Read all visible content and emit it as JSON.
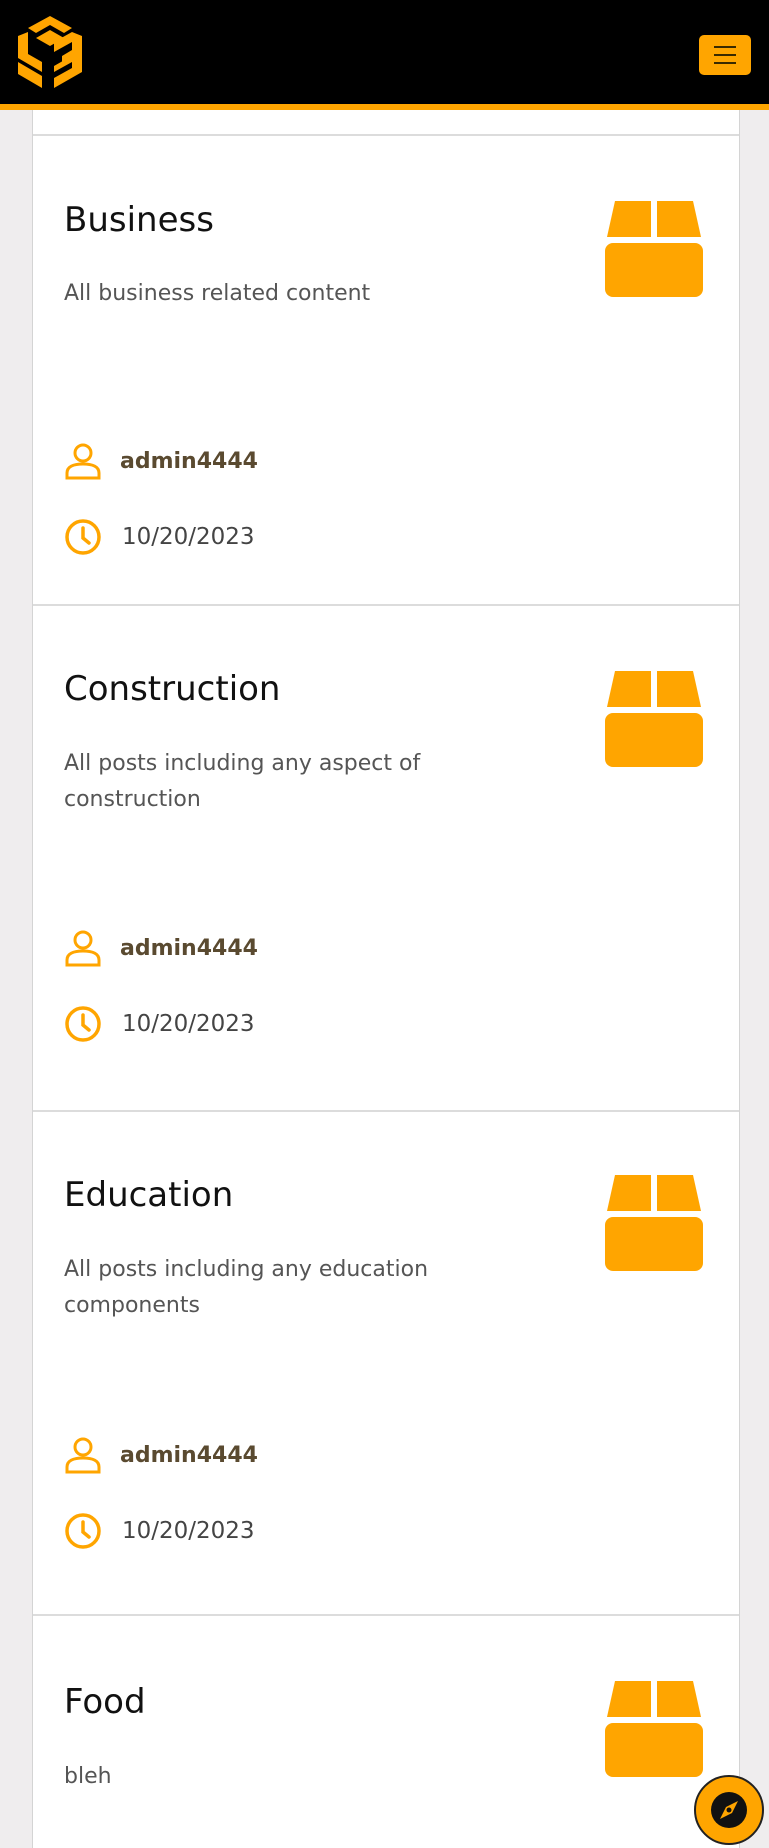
{
  "header": {
    "logo_alt": "site-logo",
    "menu_label": "Toggle navigation"
  },
  "accent_color": "#ffa500",
  "categories": [
    {
      "title": "Business",
      "description": "All business related content",
      "author": "admin4444",
      "date": "10/20/2023",
      "icon": "box-icon"
    },
    {
      "title": "Construction",
      "description": "All posts including any aspect of construction",
      "author": "admin4444",
      "date": "10/20/2023",
      "icon": "box-icon"
    },
    {
      "title": "Education",
      "description": "All posts including any education components",
      "author": "admin4444",
      "date": "10/20/2023",
      "icon": "box-icon"
    },
    {
      "title": "Food",
      "description": "bleh",
      "icon": "box-icon"
    }
  ],
  "fab": {
    "icon": "compass-icon"
  }
}
